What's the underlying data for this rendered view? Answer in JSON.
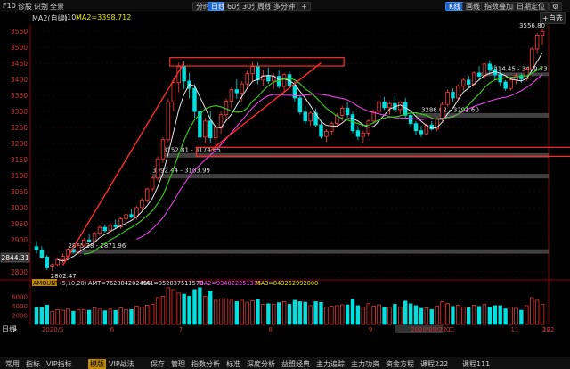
{
  "topbar": {
    "left": [
      {
        "id": "f10",
        "label": "F10"
      },
      {
        "id": "diagnose",
        "label": "诊股"
      },
      {
        "id": "recognize",
        "label": "识别"
      },
      {
        "id": "fullview",
        "label": "全景"
      }
    ],
    "periods": [
      {
        "label": "分时",
        "active": false
      },
      {
        "label": "日线",
        "active": true
      },
      {
        "label": "60分",
        "active": false
      },
      {
        "label": "30分",
        "active": false
      },
      {
        "label": "周线",
        "active": false
      },
      {
        "label": "多分钟",
        "active": false
      }
    ],
    "plus": "+",
    "right": [
      {
        "label": "K线",
        "active": true
      },
      {
        "label": "画线",
        "active": false
      },
      {
        "label": "指数叠加",
        "active": false
      },
      {
        "label": "日期定位",
        "active": false
      }
    ],
    "gear": "⚙"
  },
  "infobar": {
    "ma_label": "MA2(自编)",
    "ma_param": "(10)",
    "ma_value": "MA2=3398.712",
    "watch_button": "+自选"
  },
  "chart_data": {
    "type": "candlestick",
    "price_axis": {
      "ticks": [
        3550,
        3500,
        3450,
        3400,
        3350,
        3300,
        3250,
        3200,
        3150,
        3100,
        3050,
        3000,
        2950,
        2900,
        2850,
        2800
      ],
      "current_price_label": "2844.31",
      "range": [
        2780,
        3570
      ]
    },
    "annotations": {
      "high_label": "3556.80",
      "low_label": "2802.47",
      "zones": [
        {
          "label": "3414.45 - 3419.73"
        },
        {
          "label": "3286.02 - 3291.60"
        },
        {
          "label": "3152.81 - 3174.65"
        },
        {
          "label": "3092.44 - 3103.99"
        },
        {
          "label": "2855.38 - 2871.96"
        }
      ]
    },
    "amount_panel": {
      "indicator_name": "AMOUNT",
      "indicator_param": "(5,10,20)",
      "amt": "AMT=762884202496",
      "ma1": "MA1=952837511578",
      "ma2": "MA2=934022251315",
      "ma3": "MA3=843252992000",
      "y_ticks": [
        "6000",
        "4000",
        "2000"
      ]
    },
    "x_axis": {
      "labels": [
        "2020/5",
        "6",
        "7",
        "8",
        "9",
        "2020/09/22 二",
        "10",
        "11",
        "12",
        "202"
      ]
    },
    "series": [
      {
        "name": "candles",
        "ohlc": [
          [
            2878,
            2895,
            2856,
            2869
          ],
          [
            2868,
            2879,
            2840,
            2845
          ],
          [
            2846,
            2852,
            2805,
            2812
          ],
          [
            2815,
            2826,
            2802,
            2822
          ],
          [
            2822,
            2845,
            2815,
            2838
          ],
          [
            2838,
            2856,
            2828,
            2848
          ],
          [
            2848,
            2874,
            2842,
            2870
          ],
          [
            2870,
            2882,
            2858,
            2862
          ],
          [
            2862,
            2885,
            2855,
            2881
          ],
          [
            2881,
            2905,
            2875,
            2899
          ],
          [
            2899,
            2918,
            2890,
            2895
          ],
          [
            2895,
            2925,
            2888,
            2920
          ],
          [
            2920,
            2944,
            2912,
            2938
          ],
          [
            2938,
            2948,
            2922,
            2928
          ],
          [
            2928,
            2952,
            2920,
            2946
          ],
          [
            2946,
            2962,
            2935,
            2940
          ],
          [
            2940,
            2970,
            2934,
            2965
          ],
          [
            2965,
            2985,
            2955,
            2978
          ],
          [
            2978,
            2996,
            2966,
            2970
          ],
          [
            2970,
            3005,
            2962,
            3000
          ],
          [
            3000,
            3030,
            2990,
            3024
          ],
          [
            3024,
            3062,
            3015,
            3058
          ],
          [
            3058,
            3100,
            3050,
            3092
          ],
          [
            3092,
            3160,
            3085,
            3152
          ],
          [
            3152,
            3220,
            3140,
            3212
          ],
          [
            3212,
            3340,
            3205,
            3330
          ],
          [
            3330,
            3405,
            3300,
            3390
          ],
          [
            3390,
            3452,
            3360,
            3440
          ],
          [
            3440,
            3458,
            3370,
            3395
          ],
          [
            3395,
            3420,
            3340,
            3372
          ],
          [
            3372,
            3385,
            3280,
            3300
          ],
          [
            3300,
            3318,
            3205,
            3220
          ],
          [
            3220,
            3280,
            3200,
            3270
          ],
          [
            3270,
            3300,
            3200,
            3218
          ],
          [
            3218,
            3260,
            3195,
            3248
          ],
          [
            3248,
            3300,
            3230,
            3290
          ],
          [
            3290,
            3340,
            3270,
            3332
          ],
          [
            3332,
            3375,
            3310,
            3368
          ],
          [
            3368,
            3400,
            3340,
            3358
          ],
          [
            3358,
            3395,
            3330,
            3386
          ],
          [
            3386,
            3428,
            3370,
            3418
          ],
          [
            3418,
            3455,
            3392,
            3440
          ],
          [
            3440,
            3452,
            3385,
            3398
          ],
          [
            3398,
            3430,
            3380,
            3412
          ],
          [
            3412,
            3438,
            3386,
            3395
          ],
          [
            3395,
            3420,
            3370,
            3410
          ],
          [
            3410,
            3428,
            3372,
            3378
          ],
          [
            3378,
            3420,
            3360,
            3415
          ],
          [
            3415,
            3425,
            3375,
            3382
          ],
          [
            3382,
            3395,
            3330,
            3342
          ],
          [
            3342,
            3350,
            3290,
            3298
          ],
          [
            3298,
            3318,
            3260,
            3270
          ],
          [
            3270,
            3300,
            3255,
            3295
          ],
          [
            3295,
            3310,
            3250,
            3258
          ],
          [
            3258,
            3272,
            3215,
            3222
          ],
          [
            3222,
            3245,
            3205,
            3238
          ],
          [
            3238,
            3268,
            3225,
            3262
          ],
          [
            3262,
            3295,
            3250,
            3288
          ],
          [
            3288,
            3318,
            3270,
            3310
          ],
          [
            3310,
            3328,
            3280,
            3290
          ],
          [
            3290,
            3300,
            3232,
            3240
          ],
          [
            3240,
            3255,
            3210,
            3222
          ],
          [
            3222,
            3240,
            3200,
            3232
          ],
          [
            3232,
            3275,
            3222,
            3270
          ],
          [
            3270,
            3305,
            3262,
            3300
          ],
          [
            3300,
            3338,
            3290,
            3330
          ],
          [
            3330,
            3345,
            3305,
            3312
          ],
          [
            3312,
            3330,
            3290,
            3325
          ],
          [
            3325,
            3350,
            3300,
            3306
          ],
          [
            3306,
            3332,
            3292,
            3328
          ],
          [
            3328,
            3342,
            3280,
            3288
          ],
          [
            3288,
            3302,
            3250,
            3262
          ],
          [
            3262,
            3270,
            3225,
            3240
          ],
          [
            3240,
            3255,
            3220,
            3230
          ],
          [
            3230,
            3262,
            3225,
            3258
          ],
          [
            3258,
            3270,
            3240,
            3245
          ],
          [
            3245,
            3282,
            3238,
            3278
          ],
          [
            3278,
            3330,
            3270,
            3322
          ],
          [
            3322,
            3368,
            3315,
            3360
          ],
          [
            3360,
            3372,
            3330,
            3342
          ],
          [
            3342,
            3385,
            3338,
            3380
          ],
          [
            3380,
            3405,
            3365,
            3398
          ],
          [
            3398,
            3412,
            3375,
            3385
          ],
          [
            3385,
            3425,
            3378,
            3420
          ],
          [
            3420,
            3442,
            3400,
            3410
          ],
          [
            3410,
            3452,
            3402,
            3448
          ],
          [
            3448,
            3460,
            3420,
            3430
          ],
          [
            3430,
            3445,
            3400,
            3415
          ],
          [
            3415,
            3425,
            3380,
            3392
          ],
          [
            3392,
            3398,
            3365,
            3372
          ],
          [
            3372,
            3405,
            3365,
            3398
          ],
          [
            3398,
            3420,
            3385,
            3412
          ],
          [
            3412,
            3418,
            3390,
            3402
          ],
          [
            3402,
            3440,
            3395,
            3432
          ],
          [
            3432,
            3500,
            3425,
            3495
          ],
          [
            3495,
            3545,
            3480,
            3538
          ],
          [
            3538,
            3557,
            3508,
            3550
          ]
        ]
      },
      {
        "name": "MA2",
        "color": "#e6e600"
      }
    ]
  },
  "bottombar": {
    "items": [
      {
        "label": "常用",
        "hl": false
      },
      {
        "label": "指标",
        "hl": false
      },
      {
        "label": "VIP指标",
        "hl": false
      },
      {
        "label": "模版",
        "hl": true
      },
      {
        "label": "VIP战法",
        "hl": false
      },
      {
        "label": "保存",
        "hl": false
      },
      {
        "label": "管理",
        "hl": false
      },
      {
        "label": "指数分析",
        "hl": false
      },
      {
        "label": "标准",
        "hl": false
      },
      {
        "label": "深度分析",
        "hl": false
      },
      {
        "label": "益盟经典",
        "hl": false
      },
      {
        "label": "主力追踪",
        "hl": false
      },
      {
        "label": "主力功资",
        "hl": false
      },
      {
        "label": "资金方程",
        "hl": false
      },
      {
        "label": "课程222",
        "hl": false
      },
      {
        "label": "课程111",
        "hl": false
      }
    ]
  },
  "side_labels": {
    "riline": "日线",
    "down": "↓"
  }
}
